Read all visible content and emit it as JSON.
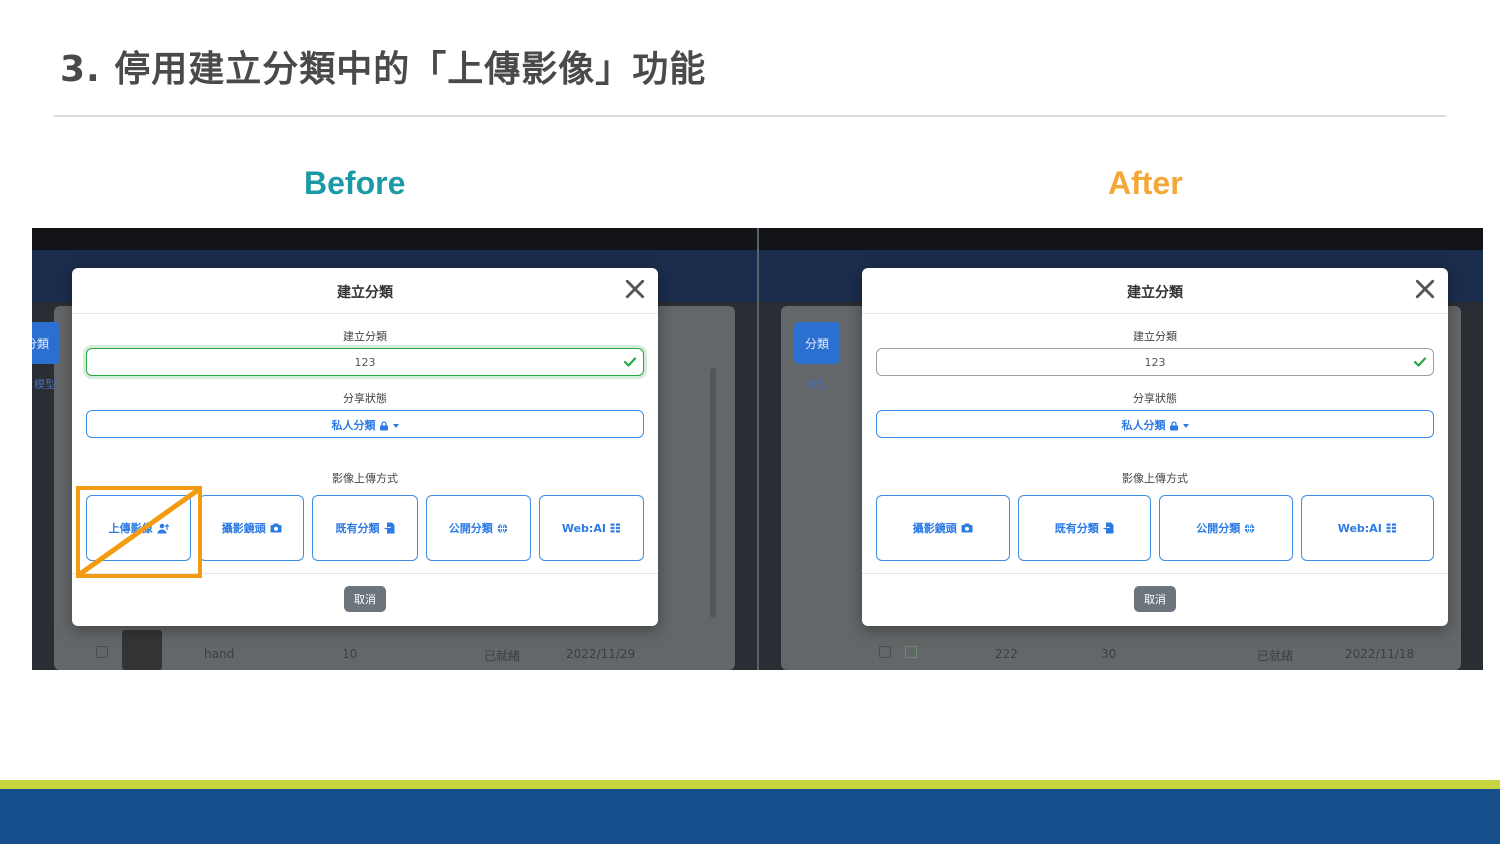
{
  "slide": {
    "title": "3. 停用建立分類中的「上傳影像」功能",
    "before_label": "Before",
    "after_label": "After"
  },
  "colors": {
    "before_label": "#1a9aa6",
    "after_label": "#f4a636",
    "disabled_mark": "#f39c12",
    "primary_blue": "#2c7be5",
    "success_green": "#28a745",
    "footer_yellow": "#c9d53e",
    "footer_blue": "#174f8d"
  },
  "before": {
    "sidebar": {
      "button_label": "分類",
      "link_label": "模型"
    },
    "modal": {
      "title": "建立分類",
      "name_label": "建立分類",
      "name_value": "123",
      "share_label": "分享狀態",
      "share_value": "私人分類",
      "upload_label": "影像上傳方式",
      "methods": [
        {
          "label": "上傳影像",
          "icon": "upload-user-icon",
          "disabled": true
        },
        {
          "label": "攝影鏡頭",
          "icon": "camera-icon"
        },
        {
          "label": "既有分類",
          "icon": "file-import-icon"
        },
        {
          "label": "公開分類",
          "icon": "globe-icon"
        },
        {
          "label": "Web:AI",
          "icon": "grid-icon"
        }
      ],
      "cancel_label": "取消"
    },
    "row": {
      "name": "hand",
      "count": "10",
      "status": "已就緒",
      "date": "2022/11/29"
    }
  },
  "after": {
    "sidebar": {
      "button_label": "分類",
      "link_label": "模型"
    },
    "modal": {
      "title": "建立分類",
      "name_label": "建立分類",
      "name_value": "123",
      "share_label": "分享狀態",
      "share_value": "私人分類",
      "upload_label": "影像上傳方式",
      "methods": [
        {
          "label": "攝影鏡頭",
          "icon": "camera-icon"
        },
        {
          "label": "既有分類",
          "icon": "file-import-icon"
        },
        {
          "label": "公開分類",
          "icon": "globe-icon"
        },
        {
          "label": "Web:AI",
          "icon": "grid-icon"
        }
      ],
      "cancel_label": "取消"
    },
    "row": {
      "name": "222",
      "count": "30",
      "status": "已就緒",
      "date": "2022/11/18"
    }
  }
}
